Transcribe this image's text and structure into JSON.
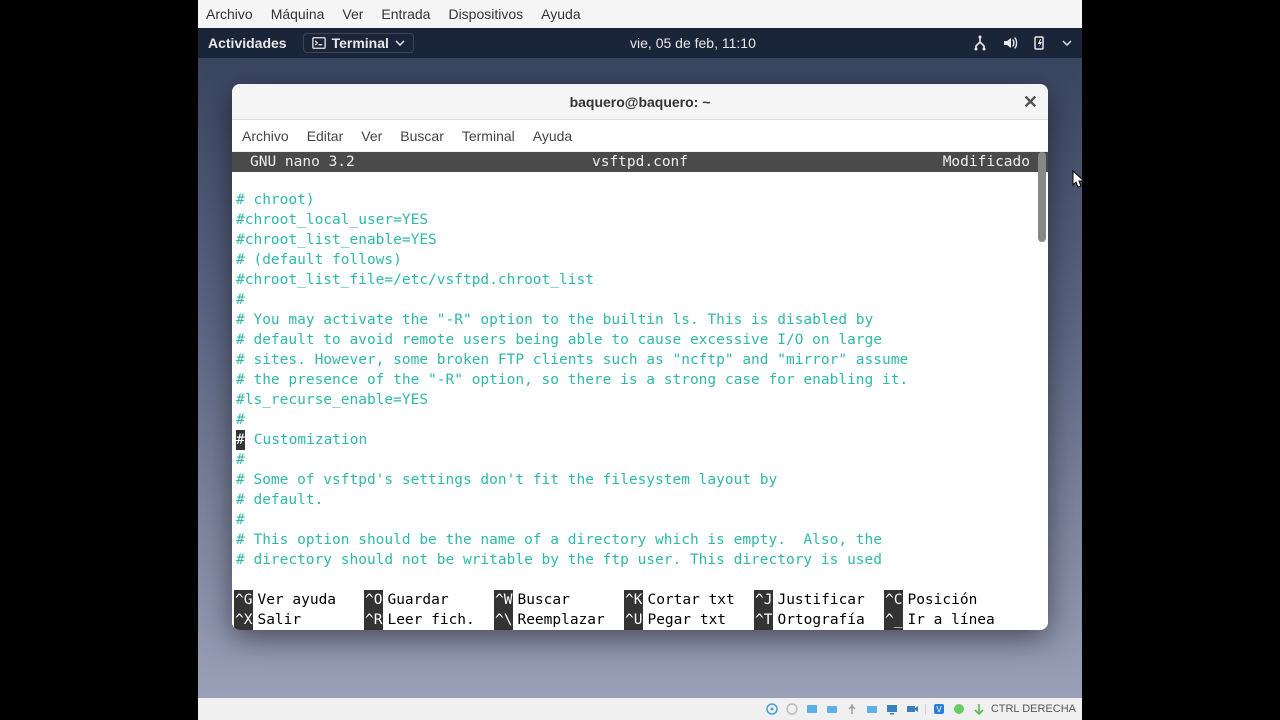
{
  "vbox_menu": {
    "archivo": "Archivo",
    "maquina": "Máquina",
    "ver": "Ver",
    "entrada": "Entrada",
    "dispositivos": "Dispositivos",
    "ayuda": "Ayuda"
  },
  "gnome": {
    "activities": "Actividades",
    "app_label": "Terminal",
    "clock": "vie, 05 de feb, 11:10"
  },
  "terminal": {
    "title": "baquero@baquero: ~",
    "menu": {
      "archivo": "Archivo",
      "editar": "Editar",
      "ver": "Ver",
      "buscar": "Buscar",
      "terminal": "Terminal",
      "ayuda": "Ayuda"
    }
  },
  "nano": {
    "app": "GNU nano 3.2",
    "file": "vsftpd.conf",
    "status": "Modificado",
    "lines": [
      "# chroot)",
      "#chroot_local_user=YES",
      "#chroot_list_enable=YES",
      "# (default follows)",
      "#chroot_list_file=/etc/vsftpd.chroot_list",
      "#",
      "# You may activate the \"-R\" option to the builtin ls. This is disabled by",
      "# default to avoid remote users being able to cause excessive I/O on large",
      "# sites. However, some broken FTP clients such as \"ncftp\" and \"mirror\" assume",
      "# the presence of the \"-R\" option, so there is a strong case for enabling it.",
      "#ls_recurse_enable=YES",
      "#",
      "# Customization",
      "#",
      "# Some of vsftpd's settings don't fit the filesystem layout by",
      "# default.",
      "#",
      "# This option should be the name of a directory which is empty.  Also, the",
      "# directory should not be writable by the ftp user. This directory is used"
    ],
    "cursor_line_index": 12,
    "shortcuts": [
      {
        "k": "^G",
        "l": "Ver ayuda"
      },
      {
        "k": "^O",
        "l": "Guardar"
      },
      {
        "k": "^W",
        "l": "Buscar"
      },
      {
        "k": "^K",
        "l": "Cortar txt"
      },
      {
        "k": "^J",
        "l": "Justificar"
      },
      {
        "k": "^C",
        "l": "Posición"
      },
      {
        "k": "^X",
        "l": "Salir"
      },
      {
        "k": "^R",
        "l": "Leer fich."
      },
      {
        "k": "^\\",
        "l": "Reemplazar"
      },
      {
        "k": "^U",
        "l": "Pegar txt"
      },
      {
        "k": "^T",
        "l": "Ortografía"
      },
      {
        "k": "^_",
        "l": "Ir a línea"
      }
    ]
  },
  "vbox_status": {
    "host_key": "CTRL DERECHA"
  }
}
